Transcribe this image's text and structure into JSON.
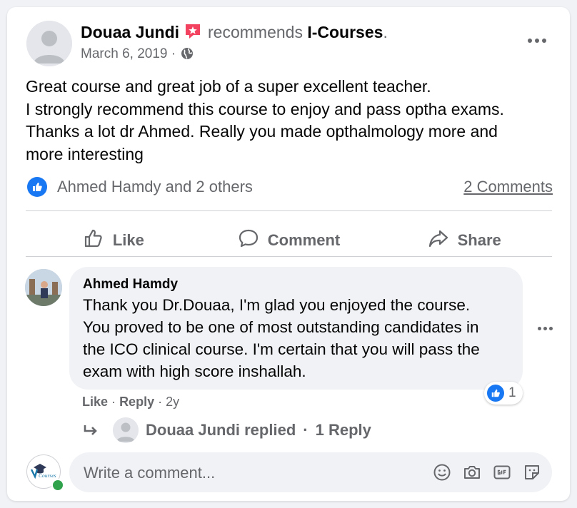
{
  "post": {
    "author": "Douaa Jundi",
    "recommends_text": "recommends",
    "page_name": "I-Courses",
    "page_name_suffix": ".",
    "date": "March 6, 2019",
    "meta_separator": "·",
    "text_lines": [
      "Great course and great job of a super excellent teacher.",
      "I strongly recommend this course to enjoy and pass optha exams.",
      "Thanks a lot dr Ahmed. Really you made opthalmology more and",
      "more interesting"
    ]
  },
  "reactions": {
    "names": "Ahmed Hamdy and 2 others",
    "comments_link": "2 Comments"
  },
  "actions": {
    "like": "Like",
    "comment": "Comment",
    "share": "Share"
  },
  "comment": {
    "author": "Ahmed Hamdy",
    "text_lines": [
      "Thank you Dr.Douaa, I'm glad you enjoyed the course.",
      "You proved to be one of most outstanding candidates in",
      "the ICO clinical course. I'm certain that you will pass the",
      "exam with high score inshallah."
    ],
    "like_count": "1",
    "like_action": "Like",
    "reply_action": "Reply",
    "separator": "·",
    "age": "2y"
  },
  "replies": {
    "label": "Douaa Jundi replied",
    "separator": "·",
    "count": "1 Reply"
  },
  "composer": {
    "placeholder": "Write a comment...",
    "avatar_text": "Courses"
  },
  "icons": {
    "recommend_badge": "recommend-star-icon",
    "privacy": "globe-icon",
    "more": "more-options-icon",
    "like": "thumbs-up-icon",
    "comment": "speech-bubble-icon",
    "share": "share-arrow-icon",
    "reply": "reply-arrow-icon",
    "emoji": "emoji-icon",
    "camera": "camera-icon",
    "gif": "gif-icon",
    "sticker": "sticker-icon"
  },
  "colors": {
    "accent": "#1877f2",
    "recommend_badge": "#f3425f",
    "online": "#31a24c",
    "secondary_text": "#65676b"
  }
}
